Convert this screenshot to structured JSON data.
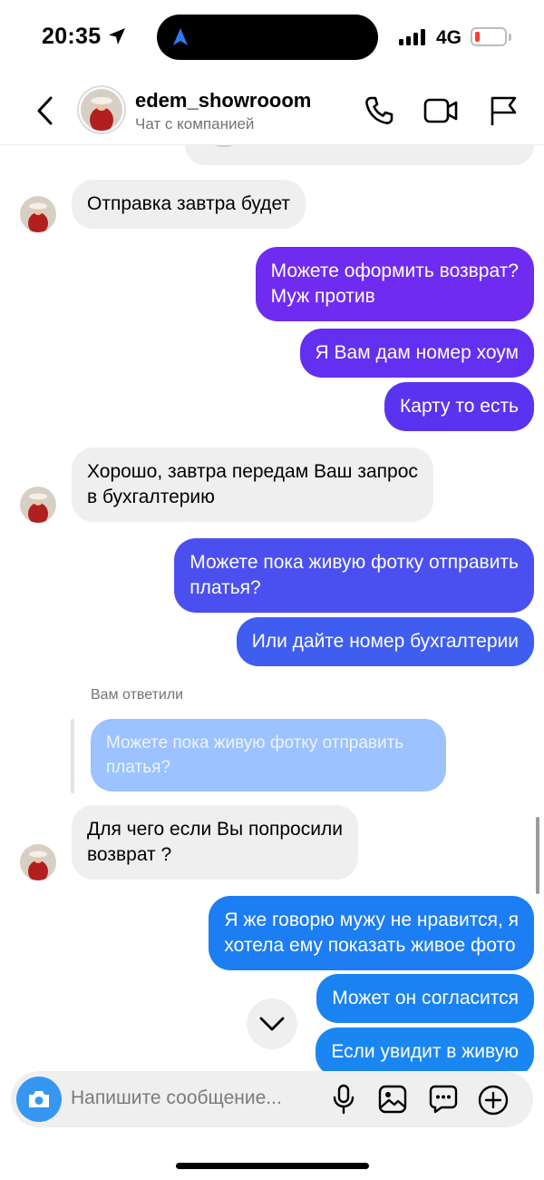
{
  "status_bar": {
    "time": "20:35",
    "network": "4G",
    "battery_level": 0.15,
    "battery_color": "#ff3b30"
  },
  "header": {
    "name": "edem_showrooom",
    "subtitle": "Чат с компанией",
    "icons": [
      "back-icon",
      "phone-icon",
      "video-icon",
      "flag-icon"
    ]
  },
  "messages": [
    {
      "direction": "in",
      "text": "Отправка завтра будет"
    },
    {
      "direction": "out",
      "text": "Можете оформить возврат?\nМуж против"
    },
    {
      "direction": "out",
      "text": "Я Вам дам номер хоум"
    },
    {
      "direction": "out",
      "text": "Карту то есть"
    },
    {
      "direction": "in",
      "text": "Хорошо, завтра передам Ваш запрос\nв бухгалтерию"
    },
    {
      "direction": "out",
      "text": "Можете пока живую фотку отправить\nплатья?"
    },
    {
      "direction": "out",
      "text": "Или дайте номер бухгалтерии"
    },
    {
      "direction": "in",
      "text": "Для чего если Вы попросили\nвозврат ?"
    },
    {
      "direction": "out",
      "text": "Я же говорю мужу не нравится, я\nхотела ему показать живое фото"
    },
    {
      "direction": "out",
      "text": "Может он согласится"
    },
    {
      "direction": "out",
      "text": "Если увидит в живую"
    }
  ],
  "reply": {
    "label": "Вам ответили",
    "quoted_text": "Можете пока живую фотку отправить\nплатья?"
  },
  "composer": {
    "placeholder": "Напишите сообщение...",
    "icons": [
      "camera-icon",
      "microphone-icon",
      "gallery-icon",
      "sticker-icon",
      "add-icon"
    ]
  },
  "colors": {
    "incoming_bubble": "#efefef",
    "out_purple": "#6f2cf0",
    "out_indigo": "#4c4ff0",
    "out_blue": "#1d7df2",
    "quoted_bubble": "#9cc2ff",
    "camera_button": "#3797f0"
  }
}
